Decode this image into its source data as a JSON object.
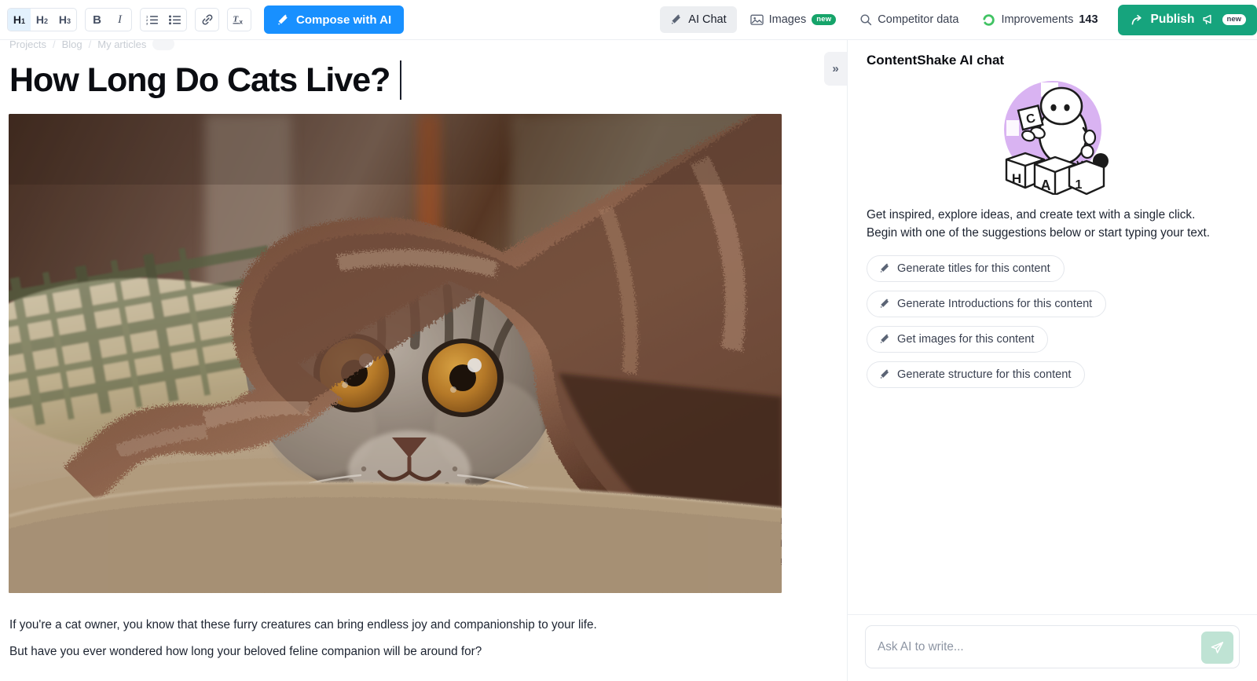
{
  "toolbar": {
    "heading_buttons": [
      {
        "label": "H",
        "sub": "1",
        "name": "h1"
      },
      {
        "label": "H",
        "sub": "2",
        "name": "h2"
      },
      {
        "label": "H",
        "sub": "3",
        "name": "h3"
      }
    ],
    "bold_label": "B",
    "italic_label": "I",
    "ordered_list_icon": "ordered-list-icon",
    "bullet_list_icon": "bullet-list-icon",
    "link_icon": "link-icon",
    "clear_format_label": "T",
    "clear_format_sub": "x",
    "compose_label": "Compose with AI",
    "compose_icon": "magic-wand-icon",
    "accent_blue": "#1890ff"
  },
  "nav": {
    "tabs": [
      {
        "label": "AI Chat",
        "icon": "magic-wand-icon",
        "selected": true,
        "badge": ""
      },
      {
        "label": "Images",
        "icon": "image-icon",
        "selected": false,
        "badge": "new"
      },
      {
        "label": "Competitor data",
        "icon": "search-icon",
        "selected": false,
        "badge": ""
      }
    ],
    "improvements_label": "Improvements",
    "improvements_count": "143",
    "improvements_icon": "progress-ring-icon",
    "publish_label": "Publish",
    "publish_icon": "share-arrow-icon",
    "publish_megaphone_icon": "megaphone-icon",
    "publish_badge": "new",
    "publish_color": "#16a47d",
    "badge_green": "#16a46a"
  },
  "editor": {
    "breadcrumb": [
      {
        "label": "Projects"
      },
      {
        "label": "Blog"
      },
      {
        "label": "My articles"
      }
    ],
    "breadcrumb_separator": "/",
    "title": "How Long Do Cats Live?",
    "hero_image_alt": "Scottish fold tabby cat peeking out from under a brown fluffy blanket on a beige couch",
    "paragraphs": [
      "If you're a cat owner, you know that these furry creatures can bring endless joy and companionship to your life.",
      "But have you ever wondered how long your beloved feline companion will be around for?"
    ]
  },
  "collapse_toggle": {
    "label": "»",
    "icon": "chevron-double-right-icon"
  },
  "chat": {
    "title": "ContentShake AI chat",
    "robot_icon": "robot-blocks-illustration",
    "robot_blocks": [
      "C",
      "H",
      "A",
      "1"
    ],
    "robot_bg_color": "#d9b3f2",
    "intro": "Get inspired, explore ideas, and create text with a single click. Begin with one of the suggestions below or start typing your text.",
    "suggestions": [
      {
        "label": "Generate titles for this content",
        "icon": "magic-wand-icon"
      },
      {
        "label": "Generate Introductions for this content",
        "icon": "magic-wand-icon"
      },
      {
        "label": "Get images for this content",
        "icon": "magic-wand-icon"
      },
      {
        "label": "Generate structure for this content",
        "icon": "magic-wand-icon"
      }
    ],
    "input_placeholder": "Ask AI to write...",
    "input_value": "",
    "send_icon": "send-paper-plane-icon",
    "send_bg_color": "#bfe3d4"
  }
}
